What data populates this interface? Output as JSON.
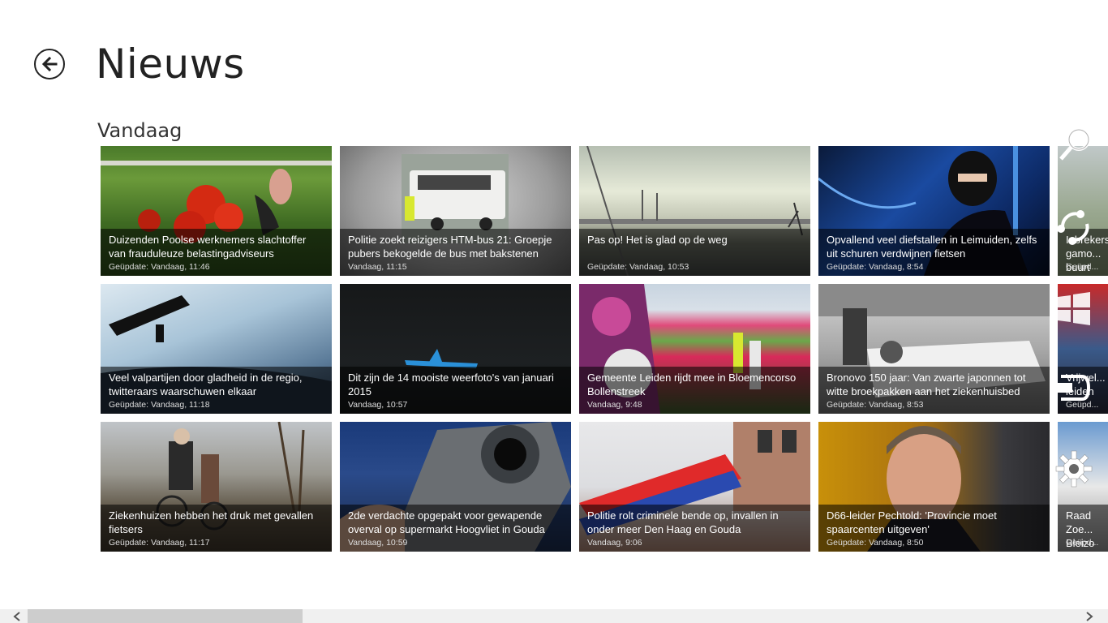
{
  "header": {
    "title": "Nieuws",
    "back_icon": "arrow-left-icon"
  },
  "section": {
    "title": "Vandaag"
  },
  "tiles": [
    {
      "headline": "Duizenden Poolse werknemers slachtoffer van frauduleuze belastingadviseurs",
      "meta": "Geüpdate: Vandaag, 11:46"
    },
    {
      "headline": "Politie zoekt reizigers HTM-bus 21: Groepje pubers bekogelde de bus met bakstenen",
      "meta": "Vandaag, 11:15"
    },
    {
      "headline": "Pas op! Het is glad op de weg",
      "meta": "Geüpdate: Vandaag, 10:53"
    },
    {
      "headline": "Opvallend veel diefstallen in Leimuiden, zelfs uit schuren verdwijnen fietsen",
      "meta": "Geüpdate: Vandaag, 8:54"
    },
    {
      "headline": "Veel valpartijen door gladheid in de regio, twitteraars waarschuwen elkaar",
      "meta": "Geüpdate: Vandaag, 11:18"
    },
    {
      "headline": "Dit zijn de 14 mooiste weerfoto's van januari 2015",
      "meta": "Vandaag, 10:57"
    },
    {
      "headline": "Gemeente Leiden rijdt mee in Bloemencorso Bollenstreek",
      "meta": "Vandaag, 9:48"
    },
    {
      "headline": "Bronovo 150 jaar: Van zwarte japonnen tot witte broekpakken aan het ziekenhuisbed",
      "meta": "Geüpdate: Vandaag, 8:53"
    },
    {
      "headline": "Ziekenhuizen hebben het druk met gevallen fietsers",
      "meta": "Geüpdate: Vandaag, 11:17"
    },
    {
      "headline": "2de verdachte opgepakt voor gewapende overval op supermarkt Hoogvliet in Gouda",
      "meta": "Vandaag, 10:59"
    },
    {
      "headline": "Politie rolt criminele bende op, invallen in onder meer Den Haag en Gouda",
      "meta": "Vandaag, 9:06"
    },
    {
      "headline": "D66-leider Pechtold: 'Provincie moet spaarcenten uitgeven'",
      "meta": "Geüpdate: Vandaag, 8:50"
    },
    {
      "headline": "Inbrekers gamo... buurt",
      "meta": "Geüpd..."
    },
    {
      "headline": "Vrijwel... leiden",
      "meta": "Geüpd..."
    },
    {
      "headline": "Raad Zoe... Bleizo",
      "meta": "Geüpd..."
    }
  ],
  "charms": [
    {
      "name": "search-charm",
      "icon": "search-icon"
    },
    {
      "name": "share-charm",
      "icon": "share-icon"
    },
    {
      "name": "start-charm",
      "icon": "windows-logo-icon"
    },
    {
      "name": "devices-charm",
      "icon": "devices-icon"
    },
    {
      "name": "settings-charm",
      "icon": "gear-icon"
    }
  ],
  "scrollbar": {
    "left_icon": "chevron-left-icon",
    "right_icon": "chevron-right-icon"
  }
}
